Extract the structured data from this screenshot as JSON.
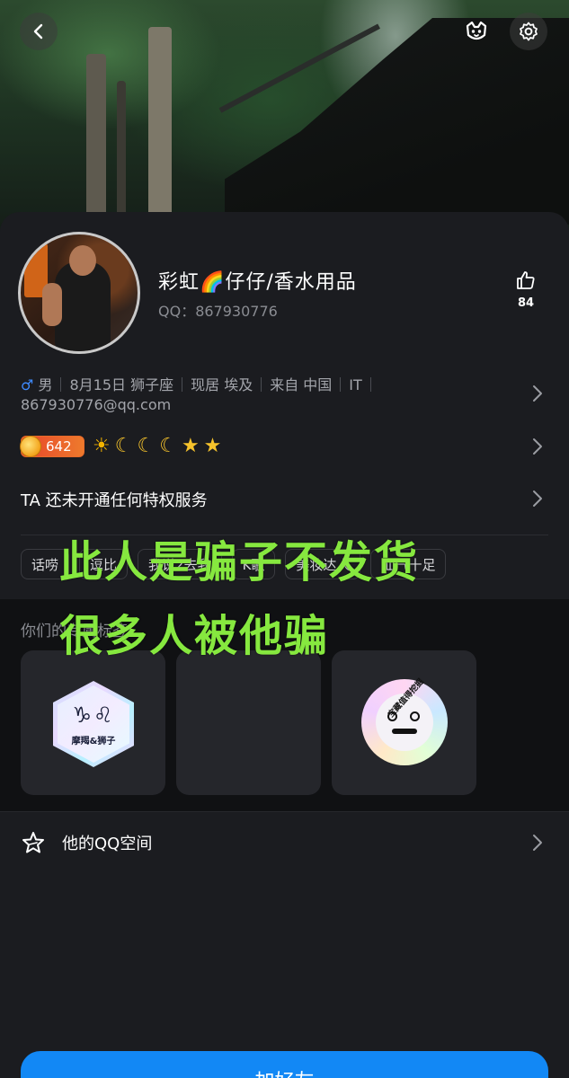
{
  "profile": {
    "nickname": "彩虹🌈仔仔/香水用品",
    "qq_label": "QQ：867930776",
    "likes": "84"
  },
  "info": {
    "gender_symbol": "♂",
    "gender": "男",
    "birthday": "8月15日",
    "zodiac": "狮子座",
    "residence": "现居 埃及",
    "hometown": "来自 中国",
    "job": "IT",
    "email": "867930776@qq.com"
  },
  "level": {
    "coin_value": "642",
    "icons": [
      "sun",
      "moon",
      "moon",
      "moon",
      "star",
      "star"
    ]
  },
  "privilege": {
    "text": "TA 还未开通任何特权服务"
  },
  "tags": [
    "话唠",
    "逗比",
    "我说2去我",
    "K歌",
    "美妆达人",
    "仙气十足"
  ],
  "medals": {
    "title": "你们的专属标签",
    "items": [
      {
        "symbols": "♑♌",
        "label": "摩羯&狮子"
      },
      {
        "label": ""
      },
      {
        "ring_text": "宝藏值得挖掘"
      }
    ]
  },
  "qzone": {
    "label": "他的QQ空间"
  },
  "action": {
    "add_friend": "加好友"
  },
  "overlay": {
    "line1": "此人是骗子不发货",
    "line2": "很多人被他骗"
  },
  "colors": {
    "accent_blue": "#1288f5",
    "overlay_green": "#86e83f",
    "card_bg": "#1b1c20"
  },
  "icons": {
    "back": "back-chevron-icon",
    "pet": "pet-face-icon",
    "settings": "gear-icon",
    "like": "thumbs-up-icon",
    "chevron": "chevron-right-icon",
    "qzone": "star-outline-icon"
  }
}
